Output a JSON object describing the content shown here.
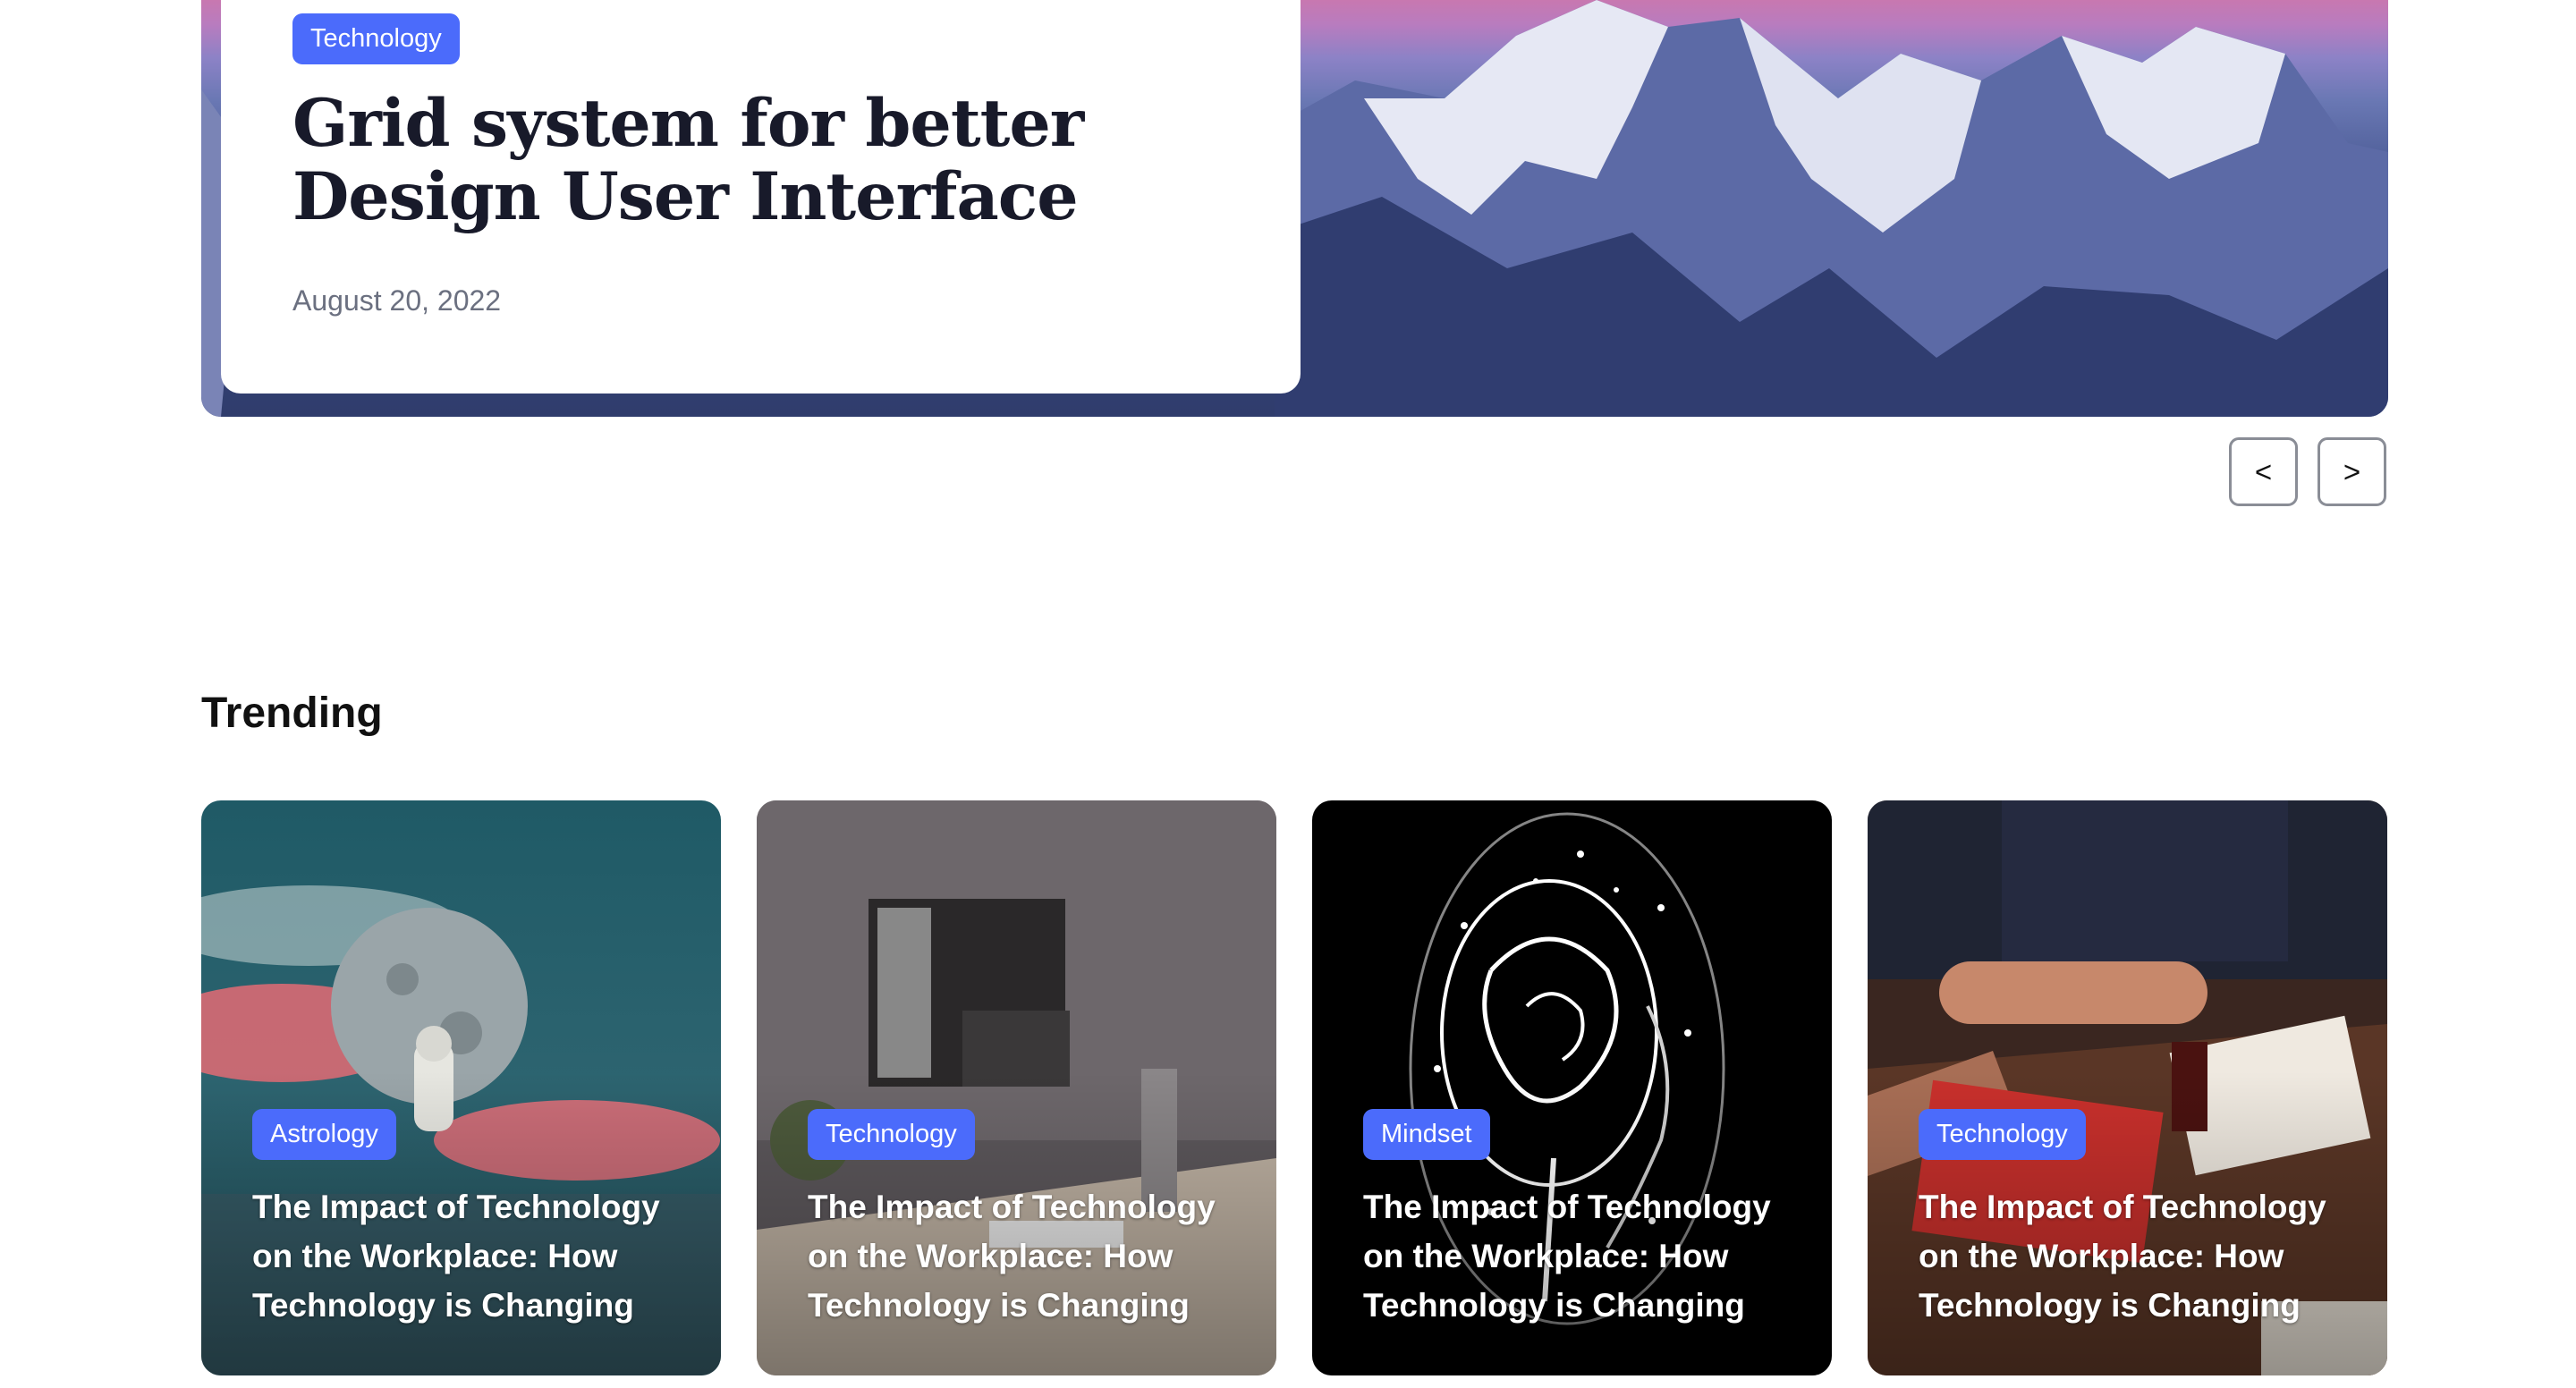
{
  "hero": {
    "category": "Technology",
    "title": "Grid system for better Design User Interface",
    "date": "August 20, 2022",
    "prev_label": "<",
    "next_label": ">"
  },
  "trending": {
    "heading": "Trending",
    "cards": [
      {
        "category": "Astrology",
        "title": "The Impact of Technology on the Workplace: How Technology is Changing"
      },
      {
        "category": "Technology",
        "title": "The Impact of Technology on the Workplace: How Technology is Changing"
      },
      {
        "category": "Mindset",
        "title": "The Impact of Technology on the Workplace: How Technology is Changing"
      },
      {
        "category": "Technology",
        "title": "The Impact of Technology on the Workplace: How Technology is Changing"
      }
    ]
  },
  "colors": {
    "accent": "#4B6BFB",
    "heading": "#181A2A",
    "muted": "#6b7080"
  }
}
